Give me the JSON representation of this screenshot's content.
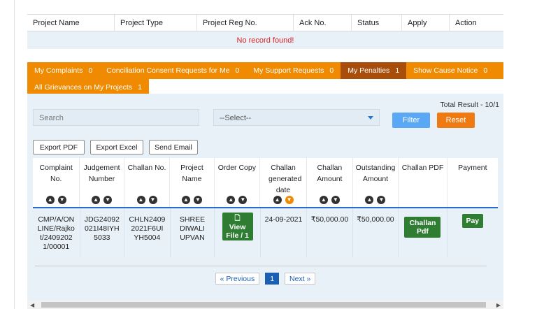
{
  "project_table": {
    "columns": [
      "Project Name",
      "Project Type",
      "Project Reg No.",
      "Ack No.",
      "Status",
      "Apply",
      "Action"
    ],
    "empty_message": "No record found!"
  },
  "tabs": {
    "row1": [
      {
        "label": "My Complaints",
        "count": "0",
        "active": false
      },
      {
        "label": "Conciliation Consent Requests for Me",
        "count": "0",
        "active": false
      },
      {
        "label": "My Support Requests",
        "count": "0",
        "active": false
      },
      {
        "label": "My Penalties",
        "count": "1",
        "active": true
      },
      {
        "label": "Show Cause Notice",
        "count": "0",
        "active": false
      }
    ],
    "row2": [
      {
        "label": "All Grievances on My Projects",
        "count": "1",
        "active": false
      }
    ]
  },
  "filters": {
    "total_result": "Total Result - 10/1",
    "search_placeholder": "Search",
    "select_value": "--Select--",
    "filter_label": "Filter",
    "reset_label": "Reset"
  },
  "exports": {
    "pdf": "Export PDF",
    "excel": "Export Excel",
    "email": "Send Email"
  },
  "penalty_table": {
    "columns": [
      {
        "label": "Complaint No.",
        "sortable": true
      },
      {
        "label": "Judgement Number",
        "sortable": true
      },
      {
        "label": "Challan No.",
        "sortable": true
      },
      {
        "label": "Project Name",
        "sortable": true
      },
      {
        "label": "Order Copy",
        "sortable": true
      },
      {
        "label": "Challan generated date",
        "sortable": true
      },
      {
        "label": "Challan Amount",
        "sortable": true
      },
      {
        "label": "Outstanding Amount",
        "sortable": true
      },
      {
        "label": "Challan PDF",
        "sortable": false
      },
      {
        "label": "Payment",
        "sortable": false
      }
    ],
    "rows": [
      {
        "complaint_no": "CMP/A/ONLINE/Rajkot/24092021/00001",
        "judgement_no": "JDG24092021I48IYH5033",
        "challan_no": "CHLN24092021F6UIYH5004",
        "project_name": "SHREE DIWALI UPVAN",
        "order_copy": "View File / 1",
        "generated_date": "24-09-2021",
        "challan_amount": "₹50,000.00",
        "outstanding_amount": "₹50,000.00",
        "challan_pdf": "Challan Pdf",
        "payment": "Pay"
      }
    ]
  },
  "pagination": {
    "previous": "« Previous",
    "current": "1",
    "next": "Next »"
  },
  "colors": {
    "tab_orange": "#f08a00",
    "tab_active": "#a84e0a",
    "filter_blue": "#5aa8f5",
    "reset_orange": "#f07a12",
    "action_green": "#2e7d32",
    "sort_highlight": "#f08a00"
  }
}
